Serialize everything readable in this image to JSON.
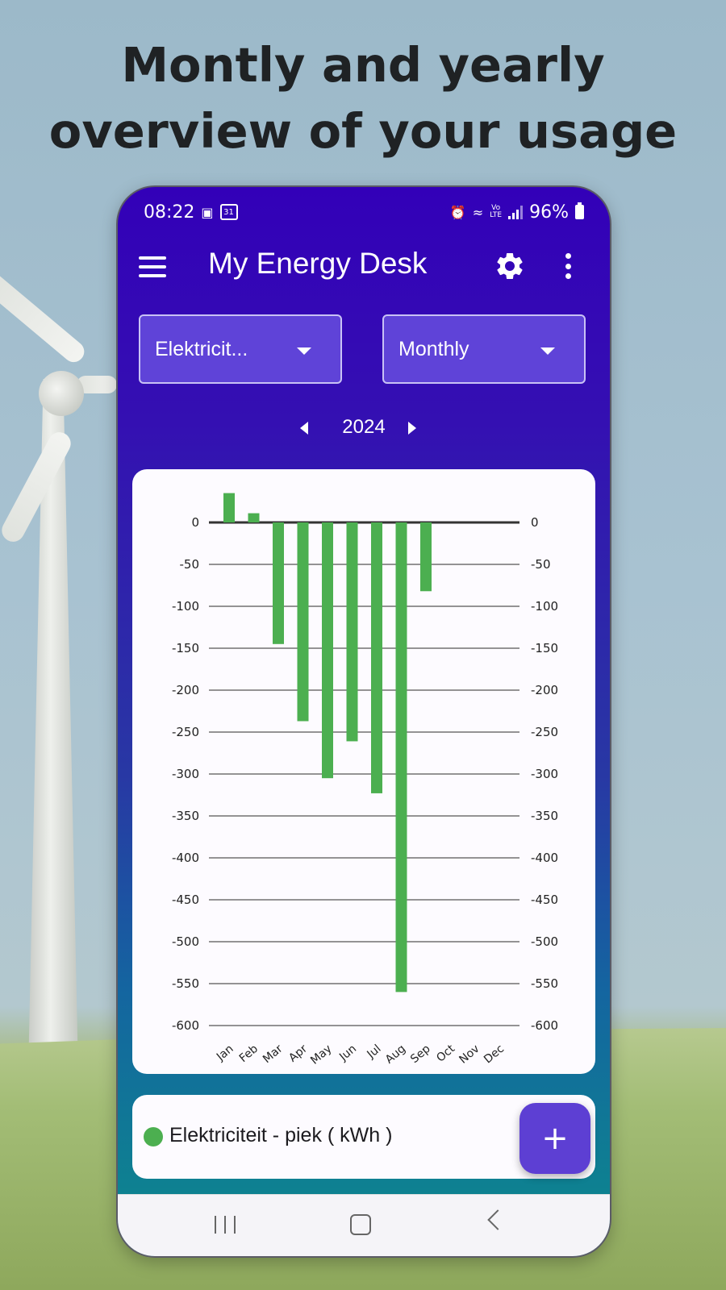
{
  "headline": {
    "line1": "Montly and yearly",
    "line2": "overview of your usage"
  },
  "status_bar": {
    "time": "08:22",
    "calendar_badge": "31",
    "battery": "96%",
    "icons": [
      "image-icon",
      "calendar-icon",
      "alarm-icon",
      "wifi-icon",
      "volte-icon",
      "signal-icon",
      "battery-icon"
    ]
  },
  "app_bar": {
    "title": "My Energy Desk",
    "icons": [
      "menu-icon",
      "gear-icon",
      "more-vert-icon"
    ]
  },
  "filters": {
    "energy_type": "Elektricit...",
    "period": "Monthly"
  },
  "year_nav": {
    "year": "2024"
  },
  "chart_data": {
    "type": "bar",
    "categories": [
      "Jan",
      "Feb",
      "Mar",
      "Apr",
      "May",
      "Jun",
      "Jul",
      "Aug",
      "Sep",
      "Oct",
      "Nov",
      "Dec"
    ],
    "series": [
      {
        "name": "Elektriciteit - piek ( kWh )",
        "color": "#4caf50",
        "values": [
          35,
          11,
          -145,
          -237,
          -305,
          -261,
          -323,
          -560,
          -82,
          null,
          null,
          null
        ]
      }
    ],
    "ylim": [
      -600,
      0
    ],
    "yticks": [
      0,
      -50,
      -100,
      -150,
      -200,
      -250,
      -300,
      -350,
      -400,
      -450,
      -500,
      -550,
      -600
    ],
    "yaxis_left": true,
    "yaxis_right": true,
    "grid": true,
    "legend": "bottom"
  },
  "legend": {
    "label": "Elektriciteit - piek ( kWh )",
    "color": "#4caf50"
  },
  "fab": {
    "label": "+"
  },
  "colors": {
    "primary": "#3300b8",
    "accent": "#5d3fd3",
    "bar": "#4caf50"
  }
}
